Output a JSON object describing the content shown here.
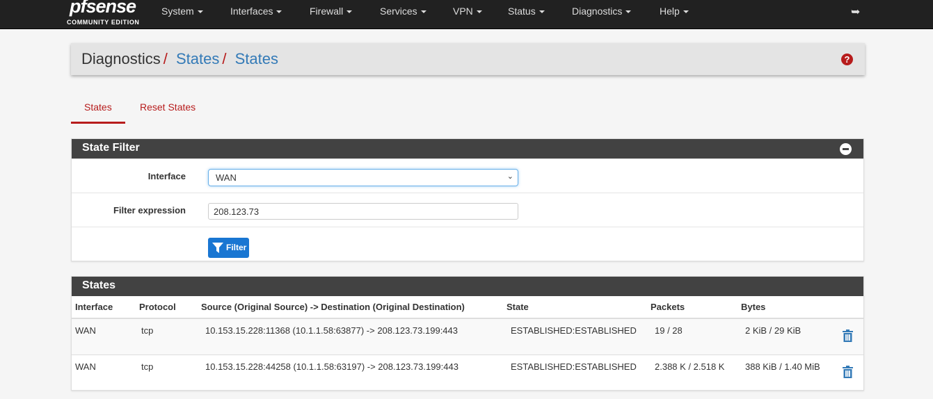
{
  "nav": {
    "logo": "pfsense",
    "edition": "COMMUNITY EDITION",
    "menus": [
      "System",
      "Interfaces",
      "Firewall",
      "Services",
      "VPN",
      "Status",
      "Diagnostics",
      "Help"
    ]
  },
  "breadcrumb": {
    "items": [
      "Diagnostics",
      "States",
      "States"
    ]
  },
  "tabs": [
    "States",
    "Reset States"
  ],
  "filter": {
    "title": "State Filter",
    "interface_label": "Interface",
    "interface_value": "WAN",
    "expr_label": "Filter expression",
    "expr_value": "208.123.73",
    "button": "Filter"
  },
  "states": {
    "title": "States",
    "columns": [
      "Interface",
      "Protocol",
      "Source (Original Source) -> Destination (Original Destination)",
      "State",
      "Packets",
      "Bytes"
    ],
    "rows": [
      [
        "WAN",
        "tcp",
        "10.153.15.228:11368 (10.1.1.58:63877) -> 208.123.73.199:443",
        "ESTABLISHED:ESTABLISHED",
        "19 / 28",
        "2 KiB / 29 KiB"
      ],
      [
        "WAN",
        "tcp",
        "10.153.15.228:44258 (10.1.1.58:63197) -> 208.123.73.199:443",
        "ESTABLISHED:ESTABLISHED",
        "2.388 K / 2.518 K",
        "388 KiB / 1.40 MiB"
      ]
    ]
  },
  "colors": {
    "accent": "#b71c1c",
    "link": "#337ab7",
    "primary": "#1976d2",
    "panel_header": "#424242"
  }
}
